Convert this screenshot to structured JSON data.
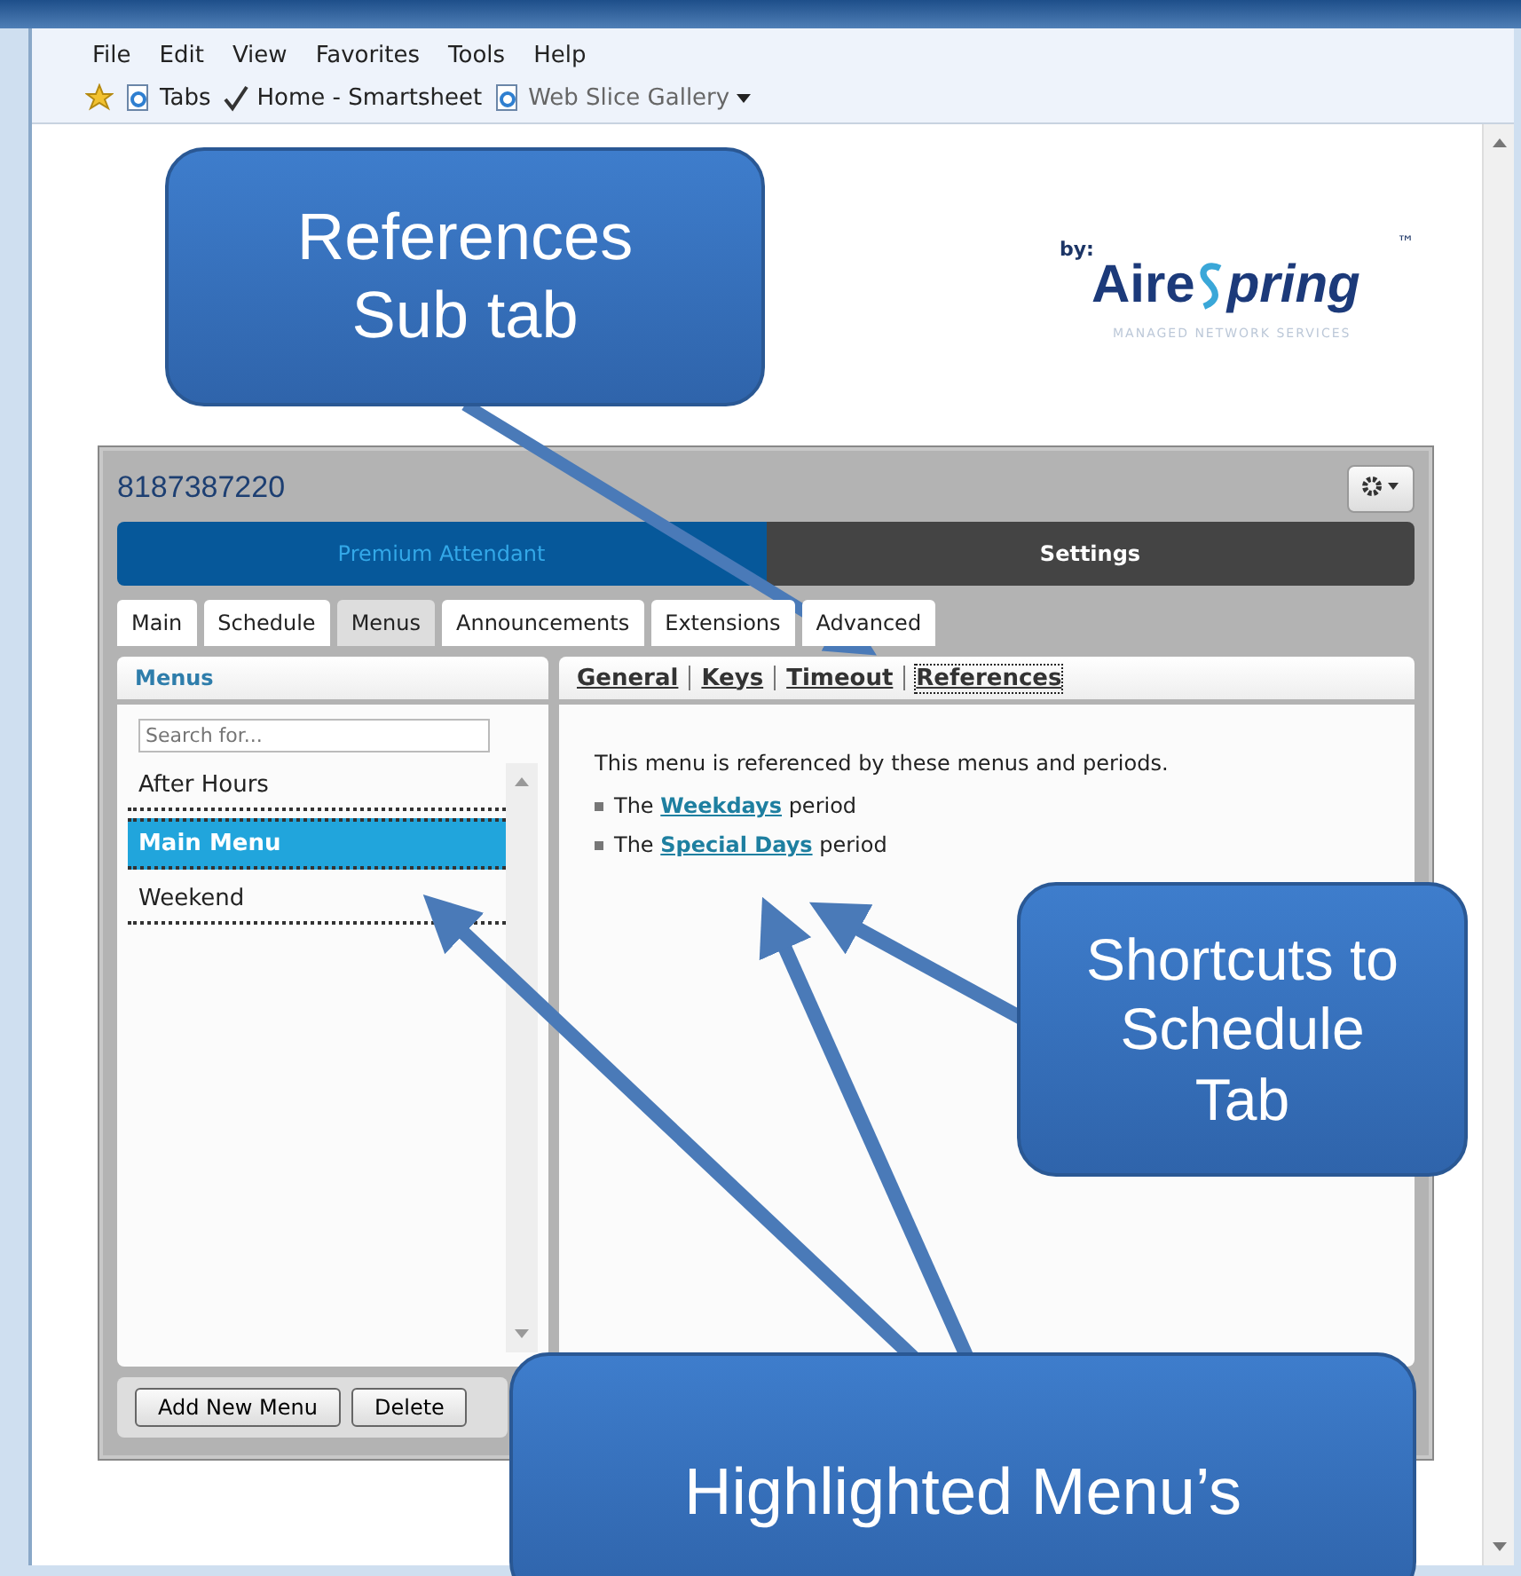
{
  "browser": {
    "menu": [
      "File",
      "Edit",
      "View",
      "Favorites",
      "Tools",
      "Help"
    ],
    "favorites": [
      {
        "label": "Tabs",
        "kind": "page",
        "dropdown": false
      },
      {
        "label": "Home - Smartsheet",
        "kind": "check",
        "dropdown": false
      },
      {
        "label": "Web Slice Gallery",
        "kind": "page",
        "dropdown": true
      }
    ]
  },
  "logo": {
    "by": "by:",
    "name_start": "Aire",
    "name_end": "pring",
    "tm": "™",
    "tagline": "MANAGED NETWORK SERVICES"
  },
  "app": {
    "phone": "8187387220",
    "sections": [
      {
        "label": "Premium Attendant",
        "selected": true
      },
      {
        "label": "Settings",
        "selected": false
      }
    ],
    "tabs": [
      {
        "label": "Main",
        "selected": false
      },
      {
        "label": "Schedule",
        "selected": false
      },
      {
        "label": "Menus",
        "selected": true
      },
      {
        "label": "Announcements",
        "selected": false
      },
      {
        "label": "Extensions",
        "selected": false
      },
      {
        "label": "Advanced",
        "selected": false
      }
    ],
    "menus_pane": {
      "title": "Menus",
      "search": {
        "placeholder": "Search for..."
      },
      "items": [
        {
          "label": "After Hours",
          "selected": false
        },
        {
          "label": "Main Menu",
          "selected": true
        },
        {
          "label": "Weekend",
          "selected": false
        }
      ],
      "buttons": [
        "Add New Menu",
        "Delete"
      ]
    },
    "subtabs": [
      {
        "label": "General",
        "selected": false
      },
      {
        "label": "Keys",
        "selected": false
      },
      {
        "label": "Timeout",
        "selected": false
      },
      {
        "label": "References",
        "selected": true
      }
    ],
    "intro": "This menu is referenced by these menus and periods.",
    "references": [
      {
        "before": "The",
        "link": "Weekdays",
        "after": "period"
      },
      {
        "before": "The",
        "link": "Special Days",
        "after": "period"
      }
    ]
  },
  "callouts": [
    {
      "lines": [
        "References",
        "Sub tab"
      ]
    },
    {
      "lines": [
        "Shortcuts to",
        "Schedule",
        "Tab"
      ]
    },
    {
      "lines": [
        "Highlighted Menu’s"
      ]
    }
  ]
}
